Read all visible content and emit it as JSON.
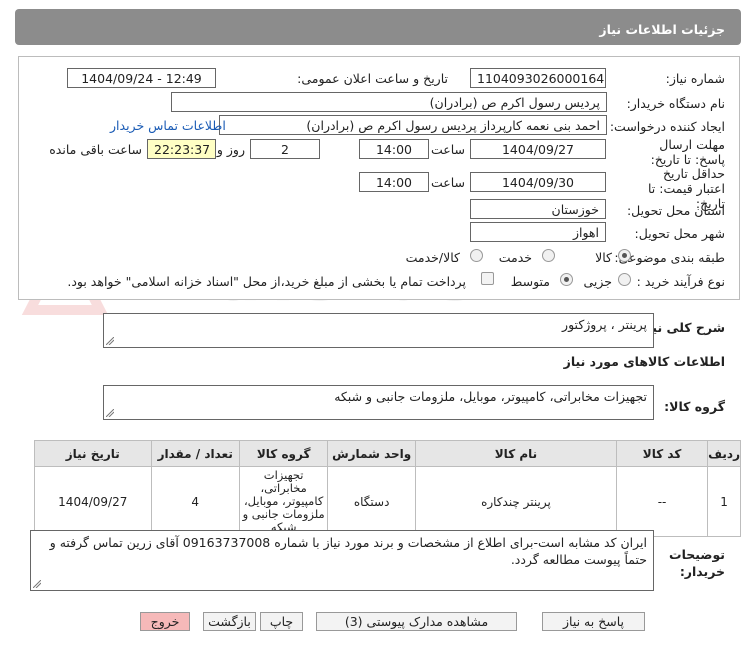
{
  "header": {
    "title": "جزئیات اطلاعات نیاز"
  },
  "form": {
    "need_number_label": "شماره نیاز:",
    "need_number": "1104093026000164",
    "announce_label": "تاریخ و ساعت اعلان عمومی:",
    "announce_value": "1404/09/24 - 12:49",
    "buyer_org_label": "نام دستگاه خریدار:",
    "buyer_org": "پردیس رسول اکرم ص (برادران)",
    "requester_label": "ایجاد کننده درخواست:",
    "requester": "احمد بنی نعمه کارپرداز پردیس رسول اکرم ص (برادران)",
    "contact_link": "اطلاعات تماس خریدار",
    "deadline_label": "مهلت ارسال پاسخ: تا تاریخ:",
    "deadline_date": "1404/09/27",
    "time_label": "ساعت",
    "deadline_time": "14:00",
    "days_value": "2",
    "days_label": "روز و",
    "remaining_time": "22:23:37",
    "remaining_label": "ساعت باقی مانده",
    "validity_label": "حداقل تاریخ اعتبار قیمت: تا تاریخ:",
    "validity_date": "1404/09/30",
    "validity_time": "14:00",
    "province_label": "استان محل تحویل:",
    "province": "خوزستان",
    "city_label": "شهر محل تحویل:",
    "city": "اهواز",
    "category_label": "طبقه بندی موضوعی:",
    "cat_goods": "کالا",
    "cat_service": "خدمت",
    "cat_goods_service": "کالا/خدمت",
    "process_label": "نوع فرآیند خرید :",
    "proc_small": "جزیی",
    "proc_medium": "متوسط",
    "payment_note": "پرداخت تمام یا بخشی از مبلغ خرید،از محل \"اسناد خزانه اسلامی\" خواهد بود."
  },
  "summary": {
    "label": "شرح کلی نیاز:",
    "value": "پرینتر ، پروژکتور"
  },
  "goods_section": {
    "title": "اطلاعات کالاهای مورد نیاز",
    "group_label": "گروه کالا:",
    "group_value": "تجهیزات مخابراتی، کامپیوتر، موبایل، ملزومات جانبی و شبکه"
  },
  "table": {
    "headers": [
      "ردیف",
      "کد کالا",
      "نام کالا",
      "واحد شمارش",
      "گروه کالا",
      "تعداد / مقدار",
      "تاریخ نیاز"
    ],
    "rows": [
      {
        "row": "1",
        "code": "--",
        "name": "پرینتر چندکاره",
        "unit": "دستگاه",
        "group": "تجهیزات مخابراتی، کامپیوتر، موبایل، ملزومات جانبی و شبکه",
        "qty": "4",
        "date": "1404/09/27"
      }
    ]
  },
  "notes": {
    "label": "توضیحات خریدار:",
    "value": "ایران کد مشابه است-برای اطلاع از مشخصات و برند مورد نیاز با شماره 09163737008 آقای زرین تماس گرفته و حتماً پیوست مطالعه گردد."
  },
  "buttons": {
    "reply": "پاسخ به نیاز",
    "attachments": "مشاهده مدارک پیوستی (3)",
    "print": "چاپ",
    "back": "بازگشت",
    "exit": "خروج"
  },
  "watermark": {
    "text": "AriaTender.neT"
  },
  "colors": {
    "header_bg": "#8c8c8c",
    "link": "#1a5bb5",
    "highlight": "#ffffc4",
    "exit_btn": "#f6b9b9"
  }
}
